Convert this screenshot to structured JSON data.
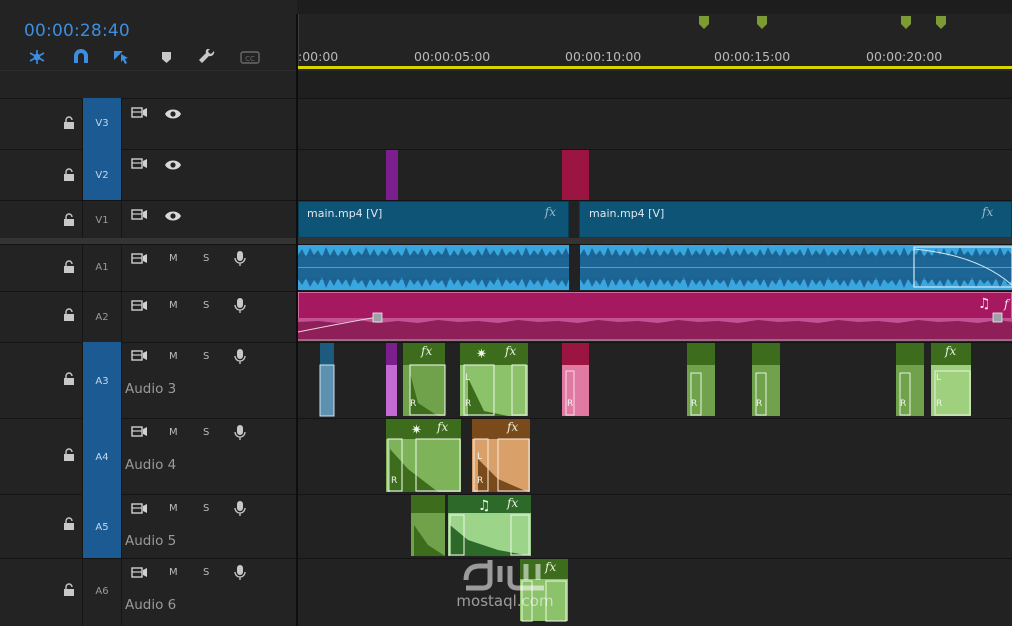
{
  "sequence": {
    "current_timecode": "00:00:28:40"
  },
  "ruler": {
    "labels": [
      ":00:00",
      "00:00:05:00",
      "00:00:10:00",
      "00:00:15:00",
      "00:00:20:00"
    ]
  },
  "toolbar": {
    "icons": [
      "snap-icon",
      "magnet-icon",
      "linked-selection-icon",
      "add-marker-icon",
      "wrench-icon",
      "captions-icon"
    ]
  },
  "tracks": {
    "video": [
      {
        "id": "V3",
        "target": true
      },
      {
        "id": "V2",
        "target": true
      },
      {
        "id": "V1",
        "target": false
      }
    ],
    "audio": [
      {
        "id": "A1",
        "target": false,
        "name": "",
        "m": "M",
        "s": "S"
      },
      {
        "id": "A2",
        "target": false,
        "name": "",
        "m": "M",
        "s": "S"
      },
      {
        "id": "A3",
        "target": true,
        "name": "Audio 3",
        "m": "M",
        "s": "S"
      },
      {
        "id": "A4",
        "target": true,
        "name": "Audio 4",
        "m": "M",
        "s": "S"
      },
      {
        "id": "A5",
        "target": true,
        "name": "Audio 5",
        "m": "M",
        "s": "S"
      },
      {
        "id": "A6",
        "target": false,
        "name": "Audio 6",
        "m": "M",
        "s": "S"
      }
    ]
  },
  "clips": {
    "v1_a": "main.mp4 [V]",
    "v1_b": "main.mp4 [V]",
    "fx": "fx",
    "r": "R",
    "l": "L"
  },
  "colors": {
    "video_clip": "#0e5476",
    "audio_clip": "#2f8dbf",
    "music_clip": "#a6185f",
    "sfx_clip": "#3d6d1c",
    "timecode": "#3c8ee0",
    "playhead_bar": "#d8d400"
  },
  "watermark": {
    "text": "mostaql.com"
  }
}
